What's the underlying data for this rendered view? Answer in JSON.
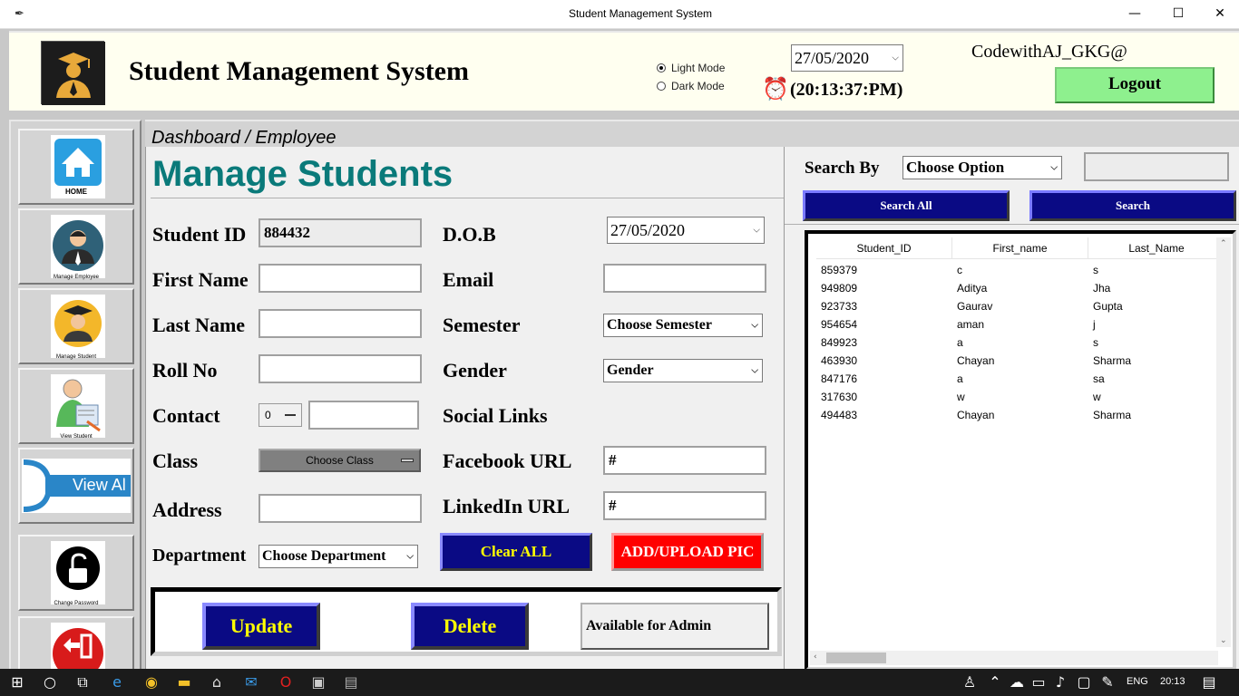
{
  "window": {
    "title": "Student Management System",
    "controls": {
      "minimize": "—",
      "maximize": "☐",
      "close": "✕"
    }
  },
  "header": {
    "app_title": "Student Management System",
    "theme_options": [
      {
        "label": "Light Mode",
        "selected": true
      },
      {
        "label": "Dark Mode",
        "selected": false
      }
    ],
    "date": "27/05/2020",
    "time": "(20:13:37:PM)",
    "user": "CodewithAJ_GKG@",
    "logout_label": "Logout",
    "logout_color": "#8ef08e"
  },
  "sidebar": {
    "items": [
      {
        "icon": "home-icon",
        "caption": "HOME"
      },
      {
        "icon": "manage-employee-icon",
        "caption": "Manage Employee"
      },
      {
        "icon": "manage-student-icon",
        "caption": "Manage Student"
      },
      {
        "icon": "view-student-icon",
        "caption": "View Student"
      },
      {
        "icon": "view-all-icon",
        "caption": "View Al"
      },
      {
        "icon": "change-password-icon",
        "caption": "Change Password"
      },
      {
        "icon": "exit-icon",
        "caption": ""
      }
    ]
  },
  "breadcrumb": "Dashboard / Employee",
  "form": {
    "title": "Manage Students",
    "title_color": "#0a7a7a",
    "fields": {
      "student_id": {
        "label": "Student ID",
        "value": "884432"
      },
      "first_name": {
        "label": "First Name",
        "value": ""
      },
      "last_name": {
        "label": "Last Name",
        "value": ""
      },
      "roll_no": {
        "label": "Roll No",
        "value": ""
      },
      "contact": {
        "label": "Contact",
        "code": "0",
        "value": ""
      },
      "class": {
        "label": "Class",
        "value": "Choose Class"
      },
      "address": {
        "label": "Address",
        "value": ""
      },
      "department": {
        "label": "Department",
        "value": "Choose Department"
      },
      "dob": {
        "label": "D.O.B",
        "value": "27/05/2020"
      },
      "email": {
        "label": "Email",
        "value": ""
      },
      "semester": {
        "label": "Semester",
        "value": "Choose Semester"
      },
      "gender": {
        "label": "Gender",
        "value": "Gender"
      },
      "social_links": {
        "label": "Social Links"
      },
      "facebook": {
        "label": "Facebook URL",
        "value": "#"
      },
      "linkedin": {
        "label": "LinkedIn URL",
        "value": "#"
      }
    },
    "clear_label": "Clear ALL",
    "upload_label": "ADD/UPLOAD PIC",
    "update_label": "Update",
    "delete_label": "Delete",
    "admin_note": "Available for Admin",
    "button_color": "#0a0a84",
    "button_text_color": "#ffff00",
    "upload_color": "#ff0000"
  },
  "search": {
    "label": "Search By",
    "option": "Choose Option",
    "query": "",
    "search_all_label": "Search All",
    "search_label": "Search"
  },
  "table": {
    "columns": [
      "Student_ID",
      "First_name",
      "Last_Name"
    ],
    "rows": [
      [
        "859379",
        "c",
        "s"
      ],
      [
        "949809",
        "Aditya",
        "Jha"
      ],
      [
        "923733",
        "Gaurav",
        "Gupta"
      ],
      [
        "954654",
        "aman",
        "j"
      ],
      [
        "849923",
        "a",
        "s"
      ],
      [
        "463930",
        "Chayan",
        "Sharma"
      ],
      [
        "847176",
        "a",
        "sa"
      ],
      [
        "317630",
        "w",
        "w"
      ],
      [
        "494483",
        "Chayan",
        "Sharma"
      ]
    ]
  },
  "taskbar": {
    "language": "ENG",
    "clock": "20:13"
  }
}
